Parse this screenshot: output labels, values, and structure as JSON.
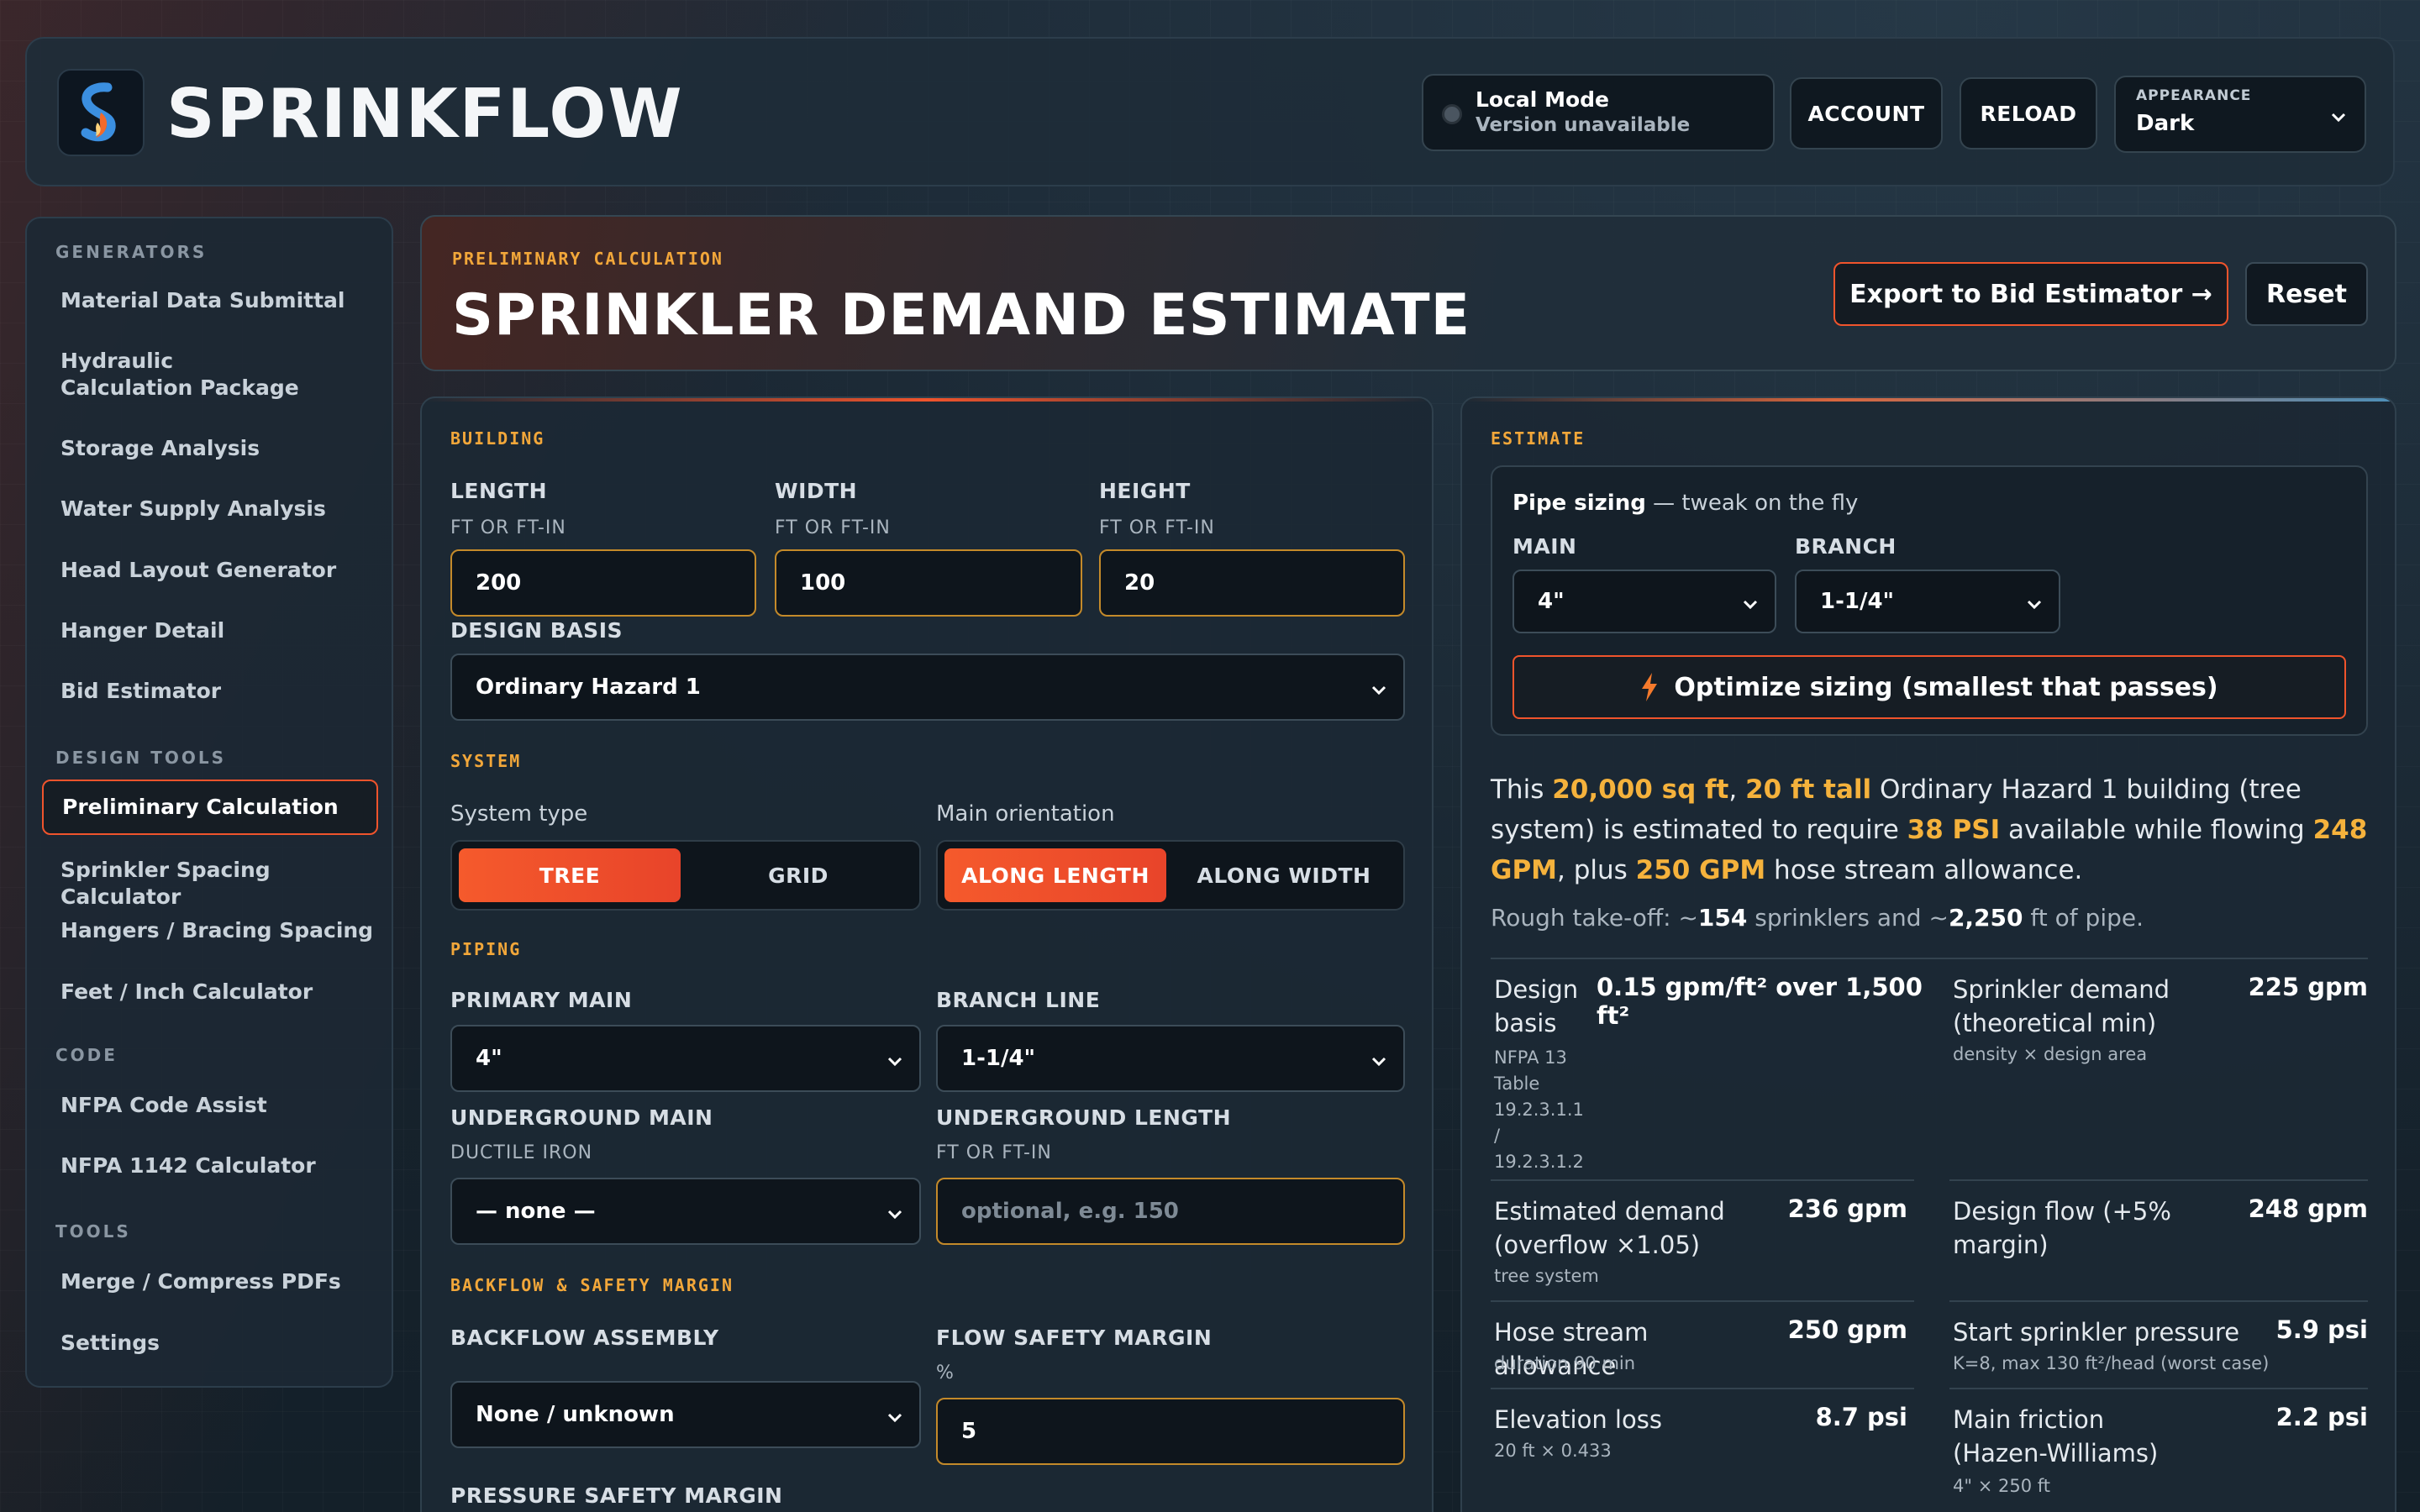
{
  "app": {
    "brand": "SPRINKFLOW",
    "mode_title": "Local Mode",
    "mode_sub": "Version unavailable",
    "account": "ACCOUNT",
    "reload": "RELOAD",
    "appearance_label": "APPEARANCE",
    "appearance_value": "Dark"
  },
  "sidebar": {
    "sections": [
      {
        "title": "GENERATORS",
        "items": [
          "Material Data Submittal",
          "Hydraulic Calculation Package",
          "Storage Analysis",
          "Water Supply Analysis",
          "Head Layout Generator",
          "Hanger Detail",
          "Bid Estimator"
        ]
      },
      {
        "title": "DESIGN TOOLS",
        "items": [
          "Preliminary Calculation",
          "Sprinkler Spacing Calculator",
          "Hangers / Bracing Spacing",
          "Feet / Inch Calculator"
        ]
      },
      {
        "title": "CODE",
        "items": [
          "NFPA Code Assist",
          "NFPA 1142 Calculator"
        ]
      },
      {
        "title": "TOOLS",
        "items": [
          "Merge / Compress PDFs",
          "Settings"
        ]
      }
    ]
  },
  "header": {
    "eyebrow": "PRELIMINARY CALCULATION",
    "title": "SPRINKLER DEMAND ESTIMATE",
    "export": "Export to Bid Estimator →",
    "reset": "Reset"
  },
  "form": {
    "building_title": "BUILDING",
    "length_label": "LENGTH",
    "length_sub": "FT OR FT-IN",
    "length_value": "200",
    "width_label": "WIDTH",
    "width_sub": "FT OR FT-IN",
    "width_value": "100",
    "height_label": "HEIGHT",
    "height_sub": "FT OR FT-IN",
    "height_value": "20",
    "design_basis_label": "DESIGN BASIS",
    "design_basis_value": "Ordinary Hazard 1",
    "system_title": "SYSTEM",
    "system_type_label": "System type",
    "system_type_opts": [
      "TREE",
      "GRID"
    ],
    "main_orient_label": "Main orientation",
    "main_orient_opts": [
      "ALONG LENGTH",
      "ALONG WIDTH"
    ],
    "piping_title": "PIPING",
    "primary_main_label": "PRIMARY MAIN",
    "primary_main_value": "4\"",
    "branch_label": "BRANCH LINE",
    "branch_value": "1-1/4\"",
    "ug_main_label": "UNDERGROUND MAIN",
    "ug_main_sub": "DUCTILE IRON",
    "ug_main_value": "— none —",
    "ug_len_label": "UNDERGROUND LENGTH",
    "ug_len_sub": "FT OR FT-IN",
    "ug_len_placeholder": "optional, e.g. 150",
    "backflow_title": "BACKFLOW & SAFETY MARGIN",
    "backflow_label": "BACKFLOW ASSEMBLY",
    "backflow_value": "None / unknown",
    "flow_margin_label": "FLOW SAFETY MARGIN",
    "flow_margin_sub": "%",
    "flow_margin_value": "5",
    "pressure_margin_label": "PRESSURE SAFETY MARGIN"
  },
  "estimate": {
    "title": "ESTIMATE",
    "pipe_sizing_bold": "Pipe sizing",
    "pipe_sizing_rest": " — tweak on the fly",
    "main_label": "MAIN",
    "main_value": "4\"",
    "branch_label": "BRANCH",
    "branch_value": "1-1/4\"",
    "optimize": "Optimize sizing (smallest that passes)",
    "summary": {
      "s1": "This ",
      "area": "20,000 sq ft",
      "s2": ", ",
      "height": "20 ft tall",
      "s3": " Ordinary Hazard 1 building (tree system) is estimated to require ",
      "psi": "38 PSI",
      "s4": " available while flowing ",
      "gpm": "248 GPM",
      "s5": ", plus ",
      "hose": "250 GPM",
      "s6": " hose stream allowance."
    },
    "takeoff": {
      "p1": "Rough take-off: ~",
      "sprinklers": "154",
      "p2": " sprinklers and ~",
      "pipe": "2,250",
      "p3": " ft of pipe."
    },
    "metrics": [
      {
        "name": "Design basis",
        "value": "0.15 gpm/ft² over 1,500 ft²",
        "note": "NFPA 13 Table 19.2.3.1.1 / 19.2.3.1.2"
      },
      {
        "name": "Sprinkler demand (theoretical min)",
        "value": "225 gpm",
        "note": "density × design area"
      },
      {
        "name": "Estimated demand (overflow ×1.05)",
        "value": "236 gpm",
        "note": "tree system"
      },
      {
        "name": "Design flow (+5% margin)",
        "value": "248 gpm",
        "note": ""
      },
      {
        "name": "Hose stream allowance",
        "value": "250 gpm",
        "note": "duration 90 min"
      },
      {
        "name": "Start sprinkler pressure",
        "value": "5.9 psi",
        "note": "K=8, max 130 ft²/head (worst case)"
      },
      {
        "name": "Elevation loss",
        "value": "8.7 psi",
        "note": "20 ft × 0.433"
      },
      {
        "name": "Main friction (Hazen-Williams)",
        "value": "2.2 psi",
        "note": "4\" × 250 ft"
      }
    ]
  },
  "colors": {
    "accent": "#f0542c",
    "highlight": "#f5b23c",
    "eyebrow": "#f2a73a"
  }
}
